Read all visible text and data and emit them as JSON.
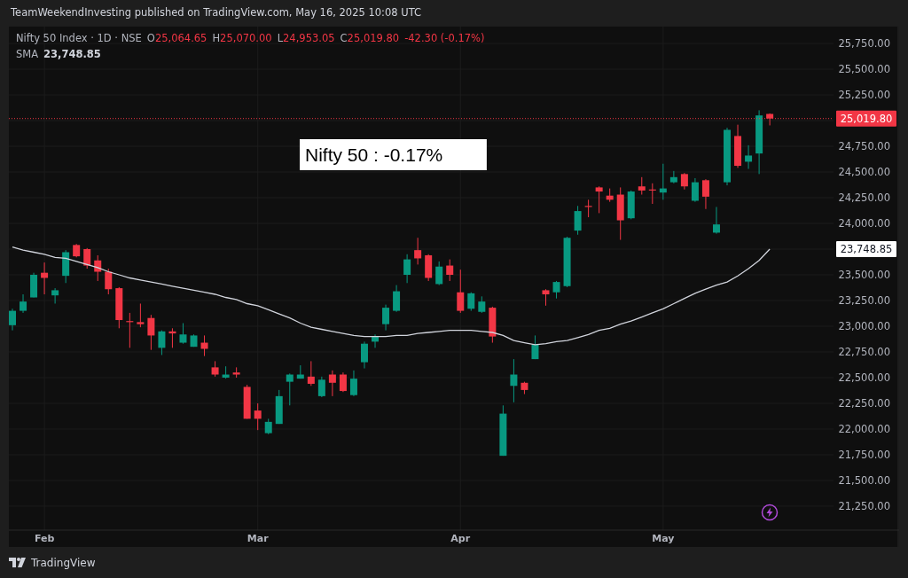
{
  "header": {
    "text": "TeamWeekendInvesting published on TradingView.com, May 16, 2025 10:08 UTC"
  },
  "legend": {
    "symbol": "Nifty 50 Index · 1D · NSE",
    "negative": true,
    "ohlc": [
      {
        "label": "O",
        "value": "25,064.65"
      },
      {
        "label": "H",
        "value": "25,070.00"
      },
      {
        "label": "L",
        "value": "24,953.05"
      },
      {
        "label": "C",
        "value": "25,019.80"
      }
    ],
    "change": "-42.30 (-0.17%)",
    "indicator_value": "23,748.85"
  },
  "chart": {
    "chart_data": {
      "type": "candlestick",
      "orientation": "vertical",
      "grid": true,
      "ylim": [
        21017,
        25914
      ],
      "categories": [
        null,
        null,
        null,
        "Feb",
        null,
        null,
        null,
        null,
        null,
        null,
        null,
        null,
        null,
        null,
        null,
        null,
        null,
        null,
        null,
        null,
        null,
        null,
        null,
        "Mar",
        null,
        null,
        null,
        null,
        null,
        null,
        null,
        null,
        null,
        null,
        null,
        null,
        null,
        null,
        null,
        null,
        null,
        null,
        "Apr",
        null,
        null,
        null,
        null,
        null,
        null,
        null,
        null,
        null,
        null,
        null,
        null,
        null,
        null,
        null,
        null,
        null,
        null,
        "May",
        null,
        null,
        null,
        null,
        null,
        null,
        null,
        null,
        null,
        null
      ],
      "yticks": [
        {
          "value": 21250,
          "label": "21,250.00"
        },
        {
          "value": 21500,
          "label": "21,500.00"
        },
        {
          "value": 21750,
          "label": "21,750.00"
        },
        {
          "value": 22000,
          "label": "22,000.00"
        },
        {
          "value": 22250,
          "label": "22,250.00"
        },
        {
          "value": 22500,
          "label": "22,500.00"
        },
        {
          "value": 22750,
          "label": "22,750.00"
        },
        {
          "value": 23000,
          "label": "23,000.00"
        },
        {
          "value": 23250,
          "label": "23,250.00"
        },
        {
          "value": 23500,
          "label": "23,500.00"
        },
        {
          "value": 24000,
          "label": "24,000.00"
        },
        {
          "value": 24250,
          "label": "24,250.00"
        },
        {
          "value": 24500,
          "label": "24,500.00"
        },
        {
          "value": 24750,
          "label": "24,750.00"
        },
        {
          "value": 25250,
          "label": "25,250.00"
        },
        {
          "value": 25500,
          "label": "25,500.00"
        },
        {
          "value": 25750,
          "label": "25,750.00"
        }
      ],
      "ohlc": [
        [
          23010,
          23170,
          22960,
          23150
        ],
        [
          23150,
          23310,
          23130,
          23240
        ],
        [
          23280,
          23520,
          23280,
          23500
        ],
        [
          23520,
          23620,
          23310,
          23470
        ],
        [
          23300,
          23370,
          23220,
          23350
        ],
        [
          23490,
          23740,
          23420,
          23720
        ],
        [
          23790,
          23800,
          23670,
          23680
        ],
        [
          23750,
          23760,
          23560,
          23590
        ],
        [
          23640,
          23690,
          23440,
          23530
        ],
        [
          23530,
          23560,
          23310,
          23360
        ],
        [
          23370,
          23380,
          22980,
          23060
        ],
        [
          23050,
          23130,
          22790,
          23040
        ],
        [
          23040,
          23220,
          22990,
          23020
        ],
        [
          23080,
          23110,
          22770,
          22910
        ],
        [
          22790,
          22960,
          22720,
          22950
        ],
        [
          22950,
          22980,
          22790,
          22930
        ],
        [
          22840,
          23030,
          22830,
          22920
        ],
        [
          22800,
          22920,
          22800,
          22910
        ],
        [
          22840,
          22910,
          22710,
          22780
        ],
        [
          22600,
          22660,
          22510,
          22530
        ],
        [
          22500,
          22610,
          22490,
          22530
        ],
        [
          22550,
          22600,
          22500,
          22530
        ],
        [
          22410,
          22430,
          22100,
          22100
        ],
        [
          22180,
          22250,
          21990,
          22100
        ],
        [
          21960,
          22100,
          21950,
          22070
        ],
        [
          22050,
          22380,
          22050,
          22320
        ],
        [
          22460,
          22540,
          22230,
          22530
        ],
        [
          22490,
          22620,
          22490,
          22530
        ],
        [
          22510,
          22660,
          22420,
          22440
        ],
        [
          22320,
          22510,
          22310,
          22480
        ],
        [
          22530,
          22570,
          22320,
          22450
        ],
        [
          22530,
          22550,
          22360,
          22370
        ],
        [
          22330,
          22570,
          22320,
          22490
        ],
        [
          22650,
          22850,
          22590,
          22830
        ],
        [
          22850,
          22920,
          22790,
          22900
        ],
        [
          23020,
          23210,
          22960,
          23180
        ],
        [
          23150,
          23400,
          23140,
          23340
        ],
        [
          23500,
          23700,
          23420,
          23650
        ],
        [
          23740,
          23860,
          23600,
          23660
        ],
        [
          23690,
          23700,
          23440,
          23470
        ],
        [
          23410,
          23630,
          23400,
          23580
        ],
        [
          23590,
          23650,
          23440,
          23500
        ],
        [
          23330,
          23550,
          23130,
          23150
        ],
        [
          23170,
          23330,
          23150,
          23320
        ],
        [
          23140,
          23290,
          23130,
          23240
        ],
        [
          23180,
          23190,
          22840,
          22900
        ],
        [
          21740,
          22230,
          21740,
          22150
        ],
        [
          22420,
          22680,
          22260,
          22530
        ],
        [
          22450,
          22460,
          22340,
          22380
        ],
        [
          22680,
          22910,
          22680,
          22820
        ],
        [
          23350,
          23360,
          23200,
          23310
        ],
        [
          23330,
          23440,
          23270,
          23430
        ],
        [
          23390,
          23870,
          23380,
          23860
        ],
        [
          23930,
          24170,
          23890,
          24120
        ],
        [
          24170,
          24230,
          24060,
          24160
        ],
        [
          24350,
          24360,
          24100,
          24310
        ],
        [
          24270,
          24340,
          24210,
          24230
        ],
        [
          24280,
          24350,
          23840,
          24030
        ],
        [
          24050,
          24320,
          24040,
          24310
        ],
        [
          24360,
          24450,
          24280,
          24320
        ],
        [
          24330,
          24390,
          24190,
          24320
        ],
        [
          24300,
          24580,
          24230,
          24340
        ],
        [
          24400,
          24510,
          24390,
          24450
        ],
        [
          24480,
          24490,
          24330,
          24360
        ],
        [
          24220,
          24440,
          24210,
          24400
        ],
        [
          24420,
          24430,
          24140,
          24260
        ],
        [
          23910,
          24160,
          23900,
          23990
        ],
        [
          24400,
          24930,
          24370,
          24910
        ],
        [
          24850,
          24960,
          24540,
          24560
        ],
        [
          24600,
          24760,
          24530,
          24660
        ],
        [
          24680,
          25100,
          24480,
          25050
        ],
        [
          25064.65,
          25070,
          24953.05,
          25019.8
        ]
      ],
      "series": [
        {
          "name": "SMA",
          "type": "line",
          "color": "#d1d4dc",
          "values": [
            23770,
            23740,
            23720,
            23700,
            23670,
            23660,
            23630,
            23600,
            23570,
            23530,
            23500,
            23470,
            23450,
            23430,
            23410,
            23390,
            23370,
            23350,
            23330,
            23310,
            23280,
            23260,
            23220,
            23200,
            23160,
            23120,
            23080,
            23030,
            22990,
            22970,
            22950,
            22930,
            22910,
            22900,
            22900,
            22900,
            22910,
            22910,
            22930,
            22940,
            22950,
            22960,
            22960,
            22960,
            22950,
            22940,
            22910,
            22860,
            22840,
            22820,
            22830,
            22850,
            22860,
            22890,
            22920,
            22960,
            22980,
            23020,
            23050,
            23090,
            23130,
            23170,
            23220,
            23270,
            23320,
            23360,
            23400,
            23430,
            23490,
            23560,
            23640,
            23750
          ]
        }
      ],
      "ref_lines": [
        {
          "axis": "y",
          "value": 25019.8,
          "color": "#f23645"
        }
      ],
      "annotations": [
        "Nifty 50 : -0.17%"
      ]
    },
    "price_badges": [
      {
        "kind": "last_price",
        "text": "25,019.80"
      },
      {
        "kind": "indicator",
        "text": "23,748.85"
      }
    ]
  },
  "footer": {
    "brand": "TradingView"
  }
}
